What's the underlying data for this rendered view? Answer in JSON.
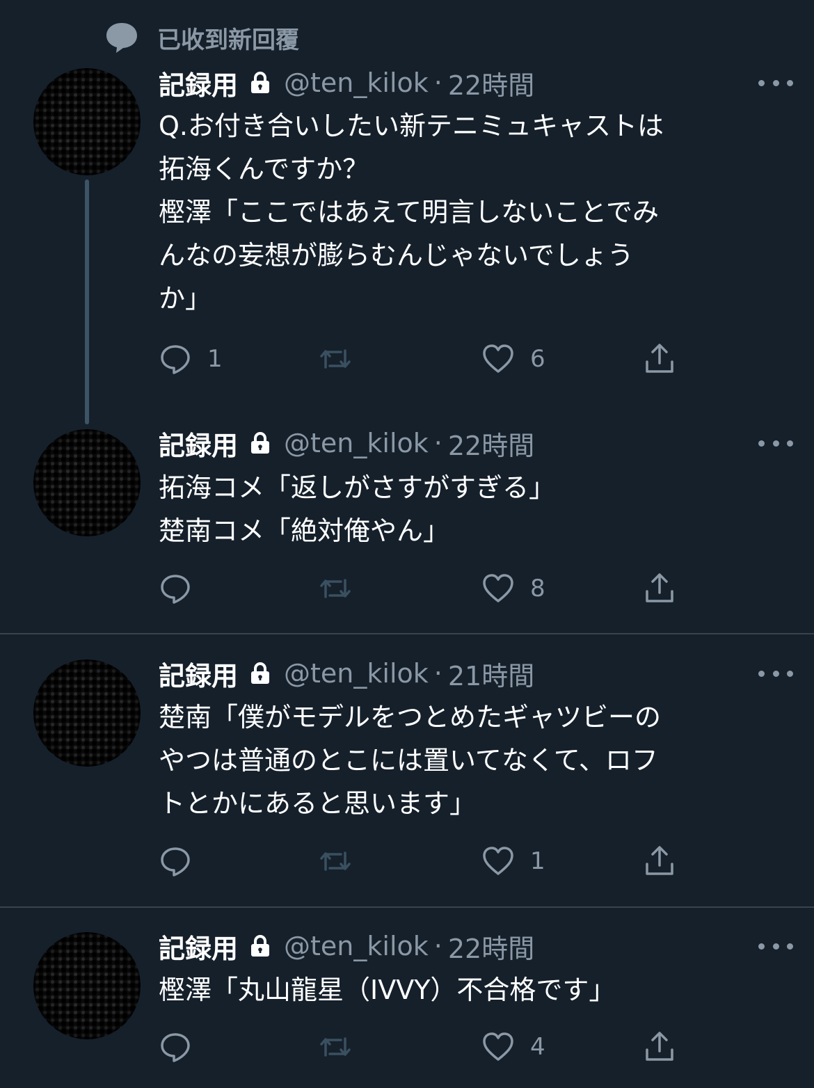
{
  "notice": {
    "label": "已收到新回覆",
    "icon": "speech-bubble-icon"
  },
  "tweets": [
    {
      "name": "記録用",
      "handle": "@ten_kilok",
      "time": "22時間",
      "text": "Q.お付き合いしたい新テニミュキャストは\n拓海くんですか？\n樫澤「ここではあえて明言しないことでみ\nんなの妄想が膨らむんじゃないでしょう\nか」",
      "replies": "1",
      "retweets": "",
      "likes": "6"
    },
    {
      "name": "記録用",
      "handle": "@ten_kilok",
      "time": "22時間",
      "text": "拓海コメ「返しがさすがすぎる」\n楚南コメ「絶対俺やん」",
      "replies": "",
      "retweets": "",
      "likes": "8"
    },
    {
      "name": "記録用",
      "handle": "@ten_kilok",
      "time": "21時間",
      "text": "楚南「僕がモデルをつとめたギャツビーの\nやつは普通のとこには置いてなくて、ロフ\nトとかにあると思います」",
      "replies": "",
      "retweets": "",
      "likes": "1"
    },
    {
      "name": "記録用",
      "handle": "@ten_kilok",
      "time": "22時間",
      "text": "樫澤「丸山龍星（IVVY）不合格です」",
      "replies": "",
      "retweets": "",
      "likes": "4"
    }
  ],
  "dot": "·",
  "colors": {
    "background": "#15202b",
    "muted": "#8b98a5",
    "divider": "#38444d",
    "thread": "#3d5466"
  }
}
